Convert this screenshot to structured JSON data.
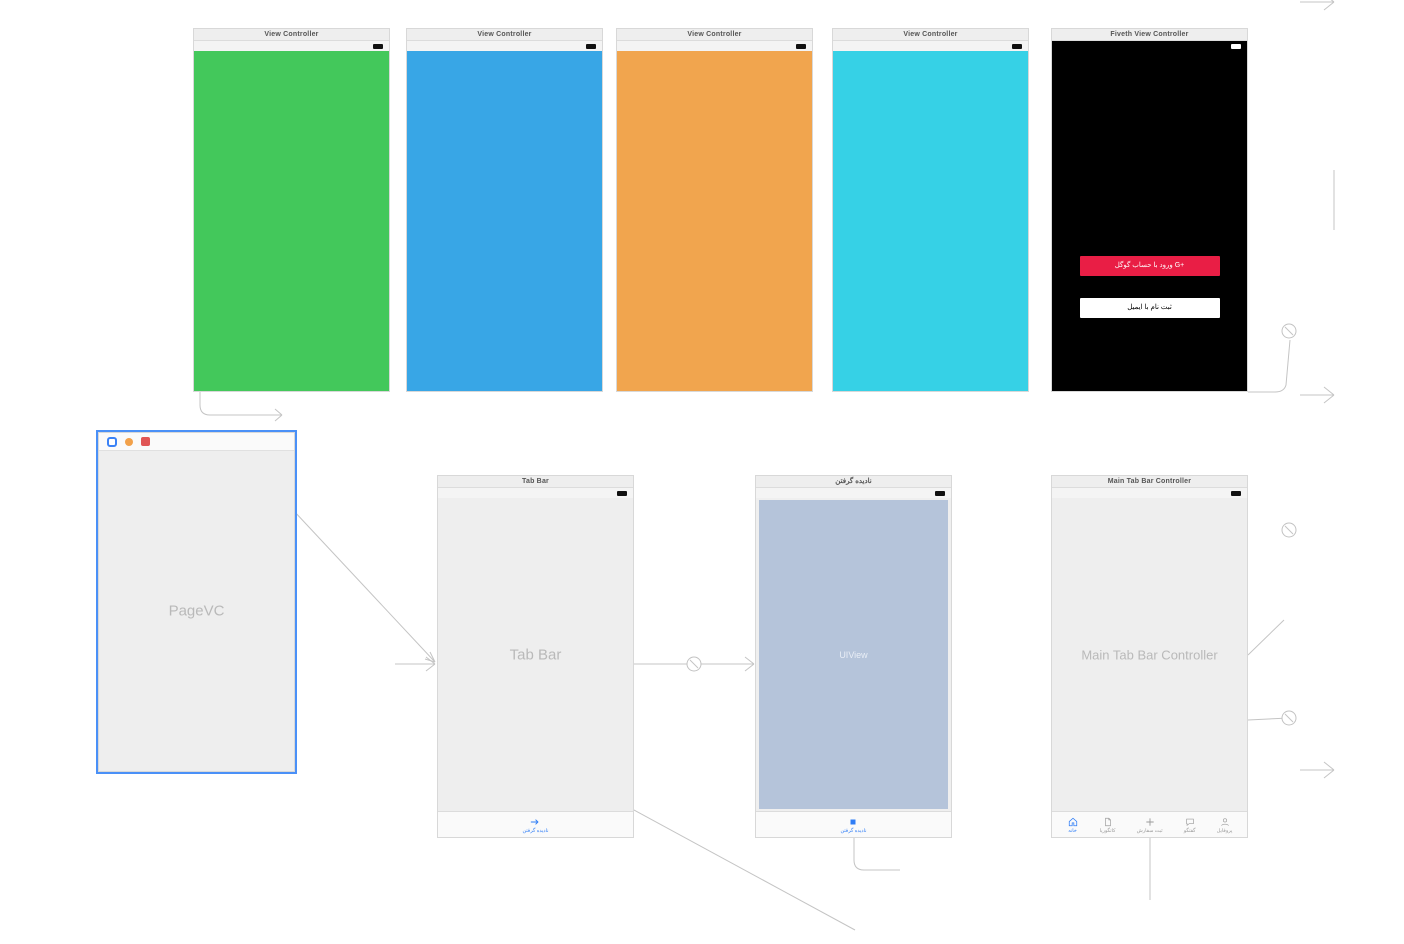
{
  "top_row": {
    "vc1": {
      "title": "View Controller",
      "bg": "#43c85b"
    },
    "vc2": {
      "title": "View Controller",
      "bg": "#38a6e6"
    },
    "vc3": {
      "title": "View Controller",
      "bg": "#f1a54e"
    },
    "vc4": {
      "title": "View Controller",
      "bg": "#36d1e6"
    },
    "fiveth": {
      "title": "Fiveth View Controller",
      "google_btn": "ورود با حساب گوگل  G+",
      "email_btn": "ثبت نام با ایمیل"
    }
  },
  "pagevc": {
    "label": "PageVC"
  },
  "tabbar_scene": {
    "title": "Tab Bar",
    "label": "Tab Bar",
    "tab_label": "نادیده گرفتن"
  },
  "ignored_scene": {
    "title": "نادیده گرفتن",
    "uiview_label": "UIView",
    "tab_label": "نادیده گرفتن"
  },
  "maintab": {
    "title": "Main Tab Bar Controller",
    "label": "Main Tab Bar Controller",
    "tabs": [
      {
        "label": "خانه",
        "icon": "home",
        "active": true
      },
      {
        "label": "کاتگوریا",
        "icon": "doc",
        "active": false
      },
      {
        "label": "ثبت سفارش",
        "icon": "plus",
        "active": false
      },
      {
        "label": "گفتگو",
        "icon": "chat",
        "active": false
      },
      {
        "label": "پروفایل",
        "icon": "person",
        "active": false
      }
    ]
  }
}
